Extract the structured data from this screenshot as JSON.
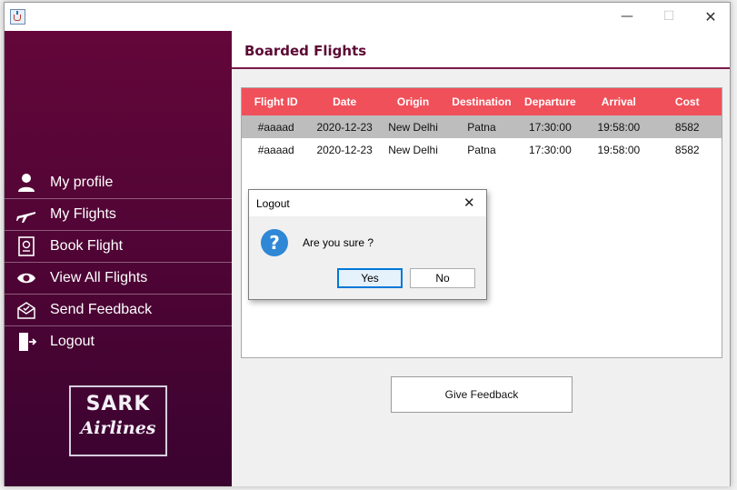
{
  "main": {
    "title": "Boarded Flights",
    "table": {
      "columns": [
        "Flight ID",
        "Date",
        "Origin",
        "Destination",
        "Departure",
        "Arrival",
        "Cost"
      ],
      "rows": [
        [
          "#aaaad",
          "2020-12-23",
          "New Delhi",
          "Patna",
          "17:30:00",
          "19:58:00",
          "8582"
        ],
        [
          "#aaaad",
          "2020-12-23",
          "New Delhi",
          "Patna",
          "17:30:00",
          "19:58:00",
          "8582"
        ]
      ],
      "selected_row": 0
    },
    "feedback_button": "Give Feedback"
  },
  "sidebar": {
    "items": [
      {
        "label": "My profile",
        "icon": "user-icon"
      },
      {
        "label": "My Flights",
        "icon": "airplane-icon"
      },
      {
        "label": "Book Flight",
        "icon": "passport-icon"
      },
      {
        "label": "View All Flights",
        "icon": "eye-icon"
      },
      {
        "label": "Send Feedback",
        "icon": "feedback-envelope-icon"
      },
      {
        "label": "Logout",
        "icon": "logout-door-icon"
      }
    ],
    "logo": {
      "line1": "SARK",
      "line2": "Airlines"
    }
  },
  "window": {
    "controls": [
      "minimize",
      "maximize",
      "close"
    ],
    "min_glyph": "—",
    "max_glyph": "☐",
    "close_glyph": "✕"
  },
  "dialog": {
    "title": "Logout",
    "message": "Are you sure ?",
    "icon": "question-icon",
    "icon_glyph": "?",
    "close_glyph": "✕",
    "yes": "Yes",
    "no": "No"
  },
  "colors": {
    "sidebar_top": "#64063a",
    "sidebar_bottom": "#3a0330",
    "table_header": "#f0505a",
    "title_color": "#5c0a35",
    "selected_row": "#bdbdbd"
  }
}
